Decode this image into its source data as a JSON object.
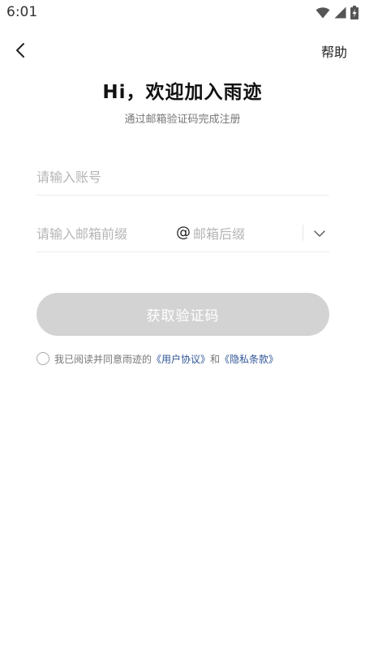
{
  "status_bar": {
    "time": "6:01",
    "icons": [
      "wifi-icon",
      "signal-icon",
      "battery-charging-icon"
    ]
  },
  "nav": {
    "back_icon": "chevron-left-icon",
    "help_label": "帮助"
  },
  "header": {
    "title": "Hi，欢迎加入雨迹",
    "subtitle": "通过邮箱验证码完成注册"
  },
  "form": {
    "account_placeholder": "请输入账号",
    "account_value": "",
    "email_prefix_placeholder": "请输入邮箱前缀",
    "email_prefix_value": "",
    "at_sign": "@",
    "email_suffix_placeholder": "邮箱后缀",
    "email_suffix_value": "",
    "dropdown_icon": "chevron-down-icon",
    "submit_label": "获取验证码",
    "submit_color": "#d3d3d3"
  },
  "agreement": {
    "checked": false,
    "prefix": "我已阅读并同意雨迹的",
    "user_agreement": "《用户协议》",
    "conjunction": "和",
    "privacy_policy": "《隐私条款》",
    "link_color": "#2f5596"
  }
}
